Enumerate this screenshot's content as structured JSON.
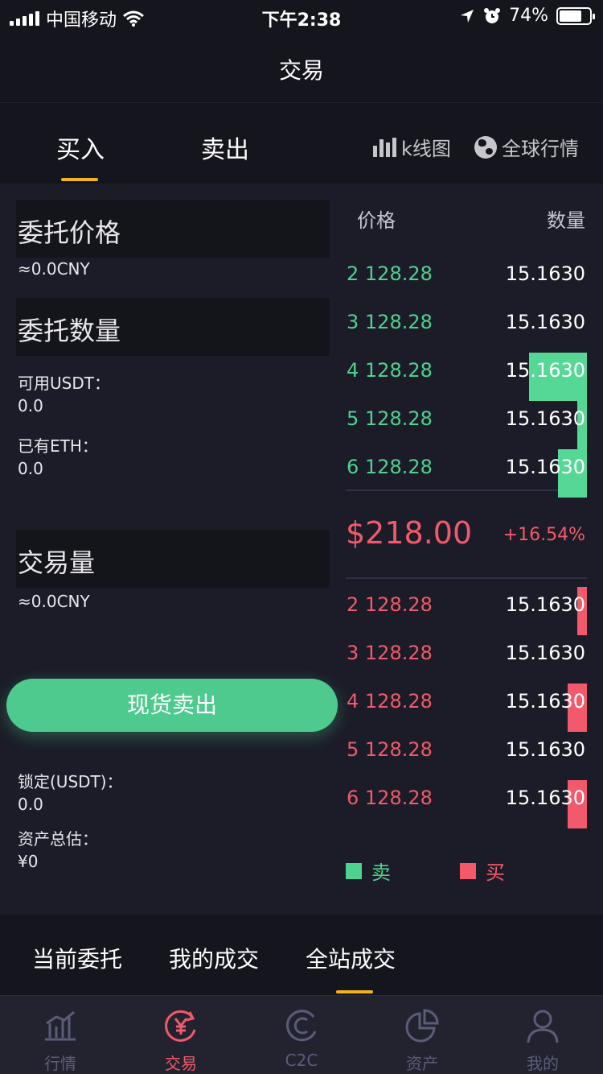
{
  "status_bar": {
    "carrier": "中国移动",
    "time": "下午2:38",
    "battery": "74%",
    "battery_level": 0.74
  },
  "nav": {
    "title": "交易"
  },
  "tabs": {
    "buy": "买入",
    "sell": "卖出",
    "kline": "k线图",
    "global": "全球行情"
  },
  "form": {
    "price_label": "委托价格",
    "price_cny": "≈0.0CNY",
    "qty_label": "委托数量",
    "avail_label": "可用USDT：",
    "avail_value": "0.0",
    "eth_label": "已有ETH：",
    "eth_value": "0.0",
    "volume_label": "交易量",
    "volume_cny": "≈0.0CNY",
    "submit": "现货卖出",
    "locked_label": "锁定(USDT)：",
    "locked_value": "0.0",
    "total_label": "资产总估：",
    "total_value": "¥0"
  },
  "order_book": {
    "price_header": "价格",
    "qty_header": "数量",
    "asks": [
      {
        "price": "2 128.28",
        "qty": "15.1630",
        "depth": 0
      },
      {
        "price": "3 128.28",
        "qty": "15.1630",
        "depth": 0
      },
      {
        "price": "4 128.28",
        "qty": "15.1630",
        "depth": 0.6
      },
      {
        "price": "5 128.28",
        "qty": "15.1630",
        "depth": 0.1
      },
      {
        "price": "6 128.28",
        "qty": "15.1630",
        "depth": 0.3
      }
    ],
    "last_price": "$218.00",
    "change": "+16.54%",
    "bids": [
      {
        "price": "2 128.28",
        "qty": "15.1630",
        "depth": 0.1
      },
      {
        "price": "3 128.28",
        "qty": "15.1630",
        "depth": 0
      },
      {
        "price": "4 128.28",
        "qty": "15.1630",
        "depth": 0.2
      },
      {
        "price": "5 128.28",
        "qty": "15.1630",
        "depth": 0
      },
      {
        "price": "6 128.28",
        "qty": "15.1630",
        "depth": 0.2
      }
    ],
    "legend_sell": "卖",
    "legend_buy": "买",
    "colors": {
      "ask": "#55d896",
      "bid": "#f25a6c"
    }
  },
  "order_tabs": [
    "当前委托",
    "我的成交",
    "全站成交"
  ],
  "tab_bar": [
    {
      "label": "行情",
      "icon": "chart-icon"
    },
    {
      "label": "交易",
      "icon": "yen-exchange-icon"
    },
    {
      "label": "C2C",
      "icon": "c2c-icon"
    },
    {
      "label": "资产",
      "icon": "pie-chart-icon"
    },
    {
      "label": "我的",
      "icon": "user-icon"
    }
  ]
}
